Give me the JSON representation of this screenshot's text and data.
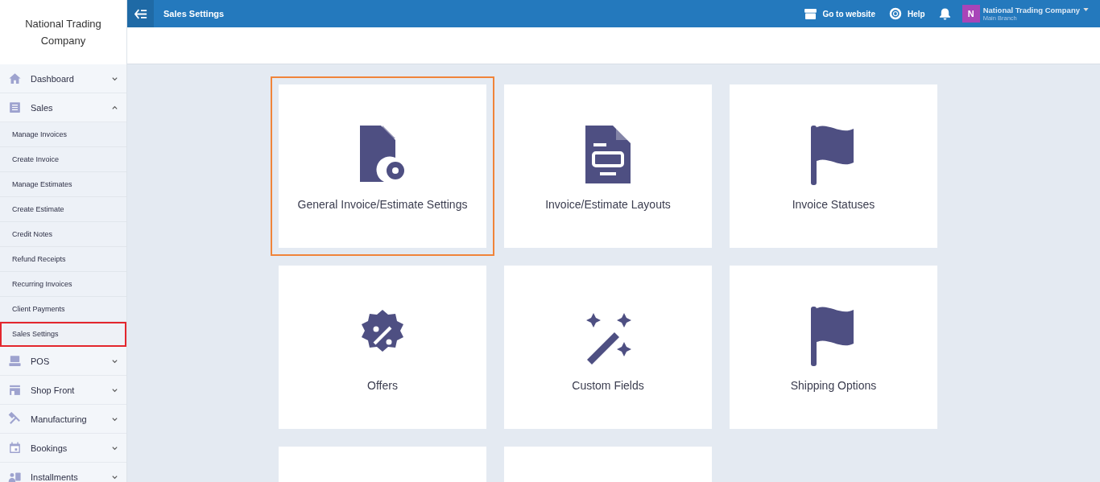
{
  "sidebar": {
    "company": "National Trading Company",
    "items": [
      {
        "kind": "home",
        "label": "Dashboard",
        "expanded": false
      },
      {
        "kind": "list",
        "label": "Sales",
        "expanded": true,
        "children": [
          {
            "label": "Manage Invoices",
            "selected": false
          },
          {
            "label": "Create Invoice",
            "selected": false
          },
          {
            "label": "Manage Estimates",
            "selected": false
          },
          {
            "label": "Create Estimate",
            "selected": false
          },
          {
            "label": "Credit Notes",
            "selected": false
          },
          {
            "label": "Refund Receipts",
            "selected": false
          },
          {
            "label": "Recurring Invoices",
            "selected": false
          },
          {
            "label": "Client Payments",
            "selected": false
          },
          {
            "label": "Sales Settings",
            "selected": true
          }
        ]
      },
      {
        "kind": "pos",
        "label": "POS",
        "expanded": false
      },
      {
        "kind": "store",
        "label": "Shop Front",
        "expanded": false
      },
      {
        "kind": "tools",
        "label": "Manufacturing",
        "expanded": false
      },
      {
        "kind": "calendar",
        "label": "Bookings",
        "expanded": false
      },
      {
        "kind": "person",
        "label": "Installments",
        "expanded": false
      }
    ]
  },
  "header": {
    "title": "Sales Settings",
    "website": "Go to website",
    "help": "Help",
    "avatar": "N",
    "account": "National Trading Company",
    "branch": "Main Branch"
  },
  "cards": [
    {
      "kind": "filegear",
      "label": "General Invoice/Estimate Settings",
      "selected": true
    },
    {
      "kind": "document",
      "label": "Invoice/Estimate Layouts",
      "selected": false
    },
    {
      "kind": "flag",
      "label": "Invoice Statuses",
      "selected": false
    },
    {
      "kind": "percent",
      "label": "Offers",
      "selected": false
    },
    {
      "kind": "wand",
      "label": "Custom Fields",
      "selected": false
    },
    {
      "kind": "flag",
      "label": "Shipping Options",
      "selected": false
    },
    {
      "kind": "blank",
      "selected": false
    },
    {
      "kind": "blank",
      "selected": false
    }
  ]
}
